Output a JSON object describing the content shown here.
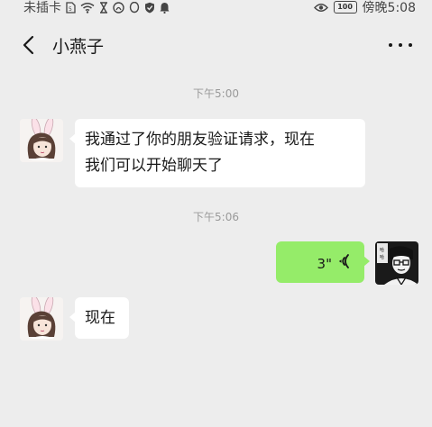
{
  "status_bar": {
    "carrier": "未插卡",
    "icons_left": [
      "sim-icon",
      "wifi-icon",
      "hourglass-icon",
      "qq-icon",
      "qq-icon",
      "shield-check-icon",
      "bell-icon"
    ],
    "battery": "100",
    "time": "傍晚5:08"
  },
  "header": {
    "title": "小燕子"
  },
  "messages": [
    {
      "type": "timestamp",
      "text": "下午5:00"
    },
    {
      "type": "text",
      "side": "left",
      "lines": [
        "我通过了你的朋友验证请求，现在",
        "我们可以开始聊天了"
      ]
    },
    {
      "type": "timestamp",
      "text": "下午5:06"
    },
    {
      "type": "voice",
      "side": "right",
      "duration": "3\""
    },
    {
      "type": "text",
      "side": "left",
      "lines": [
        "现在"
      ]
    }
  ],
  "colors": {
    "background": "#ededed",
    "self_bubble": "#95ec69",
    "peer_bubble": "#ffffff",
    "timestamp": "#9a9a9a"
  }
}
